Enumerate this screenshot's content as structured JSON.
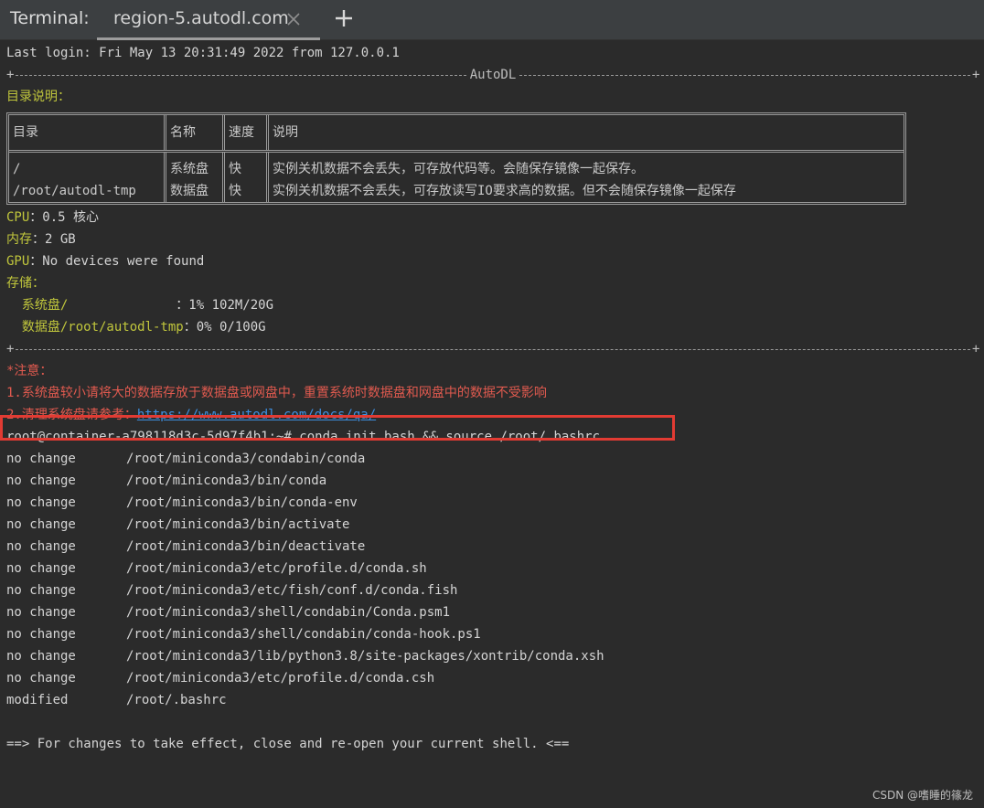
{
  "tabbar": {
    "app_label": "Terminal:",
    "tab_title": "region-5.autodl.com",
    "close_icon": "close-icon",
    "add_icon": "plus-icon"
  },
  "terminal": {
    "last_login": "Last login: Fri May 13 20:31:49 2022 from 127.0.0.1",
    "rule_top_label": "AutoDL",
    "dir_heading": "目录说明：",
    "table": {
      "headers": [
        "目录",
        "名称",
        "速度",
        "说明"
      ],
      "rows": [
        [
          "/",
          "系统盘",
          "快",
          "实例关机数据不会丢失，可存放代码等。会随保存镜像一起保存。"
        ],
        [
          "/root/autodl-tmp",
          "数据盘",
          "快",
          "实例关机数据不会丢失，可存放读写IO要求高的数据。但不会随保存镜像一起保存"
        ]
      ]
    },
    "cpu_label": "CPU",
    "cpu_value": "：0.5 核心",
    "mem_label": "内存",
    "mem_value": "：2 GB",
    "gpu_label": "GPU",
    "gpu_value": "：No devices were found",
    "storage_label": "存储：",
    "sys_disk_label": "  系统盘/",
    "sys_disk_value": "              ：1% 102M/20G",
    "data_disk_label": "  数据盘/root/autodl-tmp",
    "data_disk_value": "：0% 0/100G",
    "notice_label": "*注意：",
    "notice_1": "1.系统盘较小请将大的数据存放于数据盘或网盘中，重置系统时数据盘和网盘中的数据不受影响",
    "notice_2_prefix": "2.清理系统盘请参考：",
    "notice_2_link": "https://www.autodl.com/docs/qa/",
    "prompt_command": "root@container-a798118d3c-5d97f4b1:~# conda init bash && source /root/.bashrc",
    "outputs": [
      {
        "status": "no change",
        "path": "/root/miniconda3/condabin/conda"
      },
      {
        "status": "no change",
        "path": "/root/miniconda3/bin/conda"
      },
      {
        "status": "no change",
        "path": "/root/miniconda3/bin/conda-env"
      },
      {
        "status": "no change",
        "path": "/root/miniconda3/bin/activate"
      },
      {
        "status": "no change",
        "path": "/root/miniconda3/bin/deactivate"
      },
      {
        "status": "no change",
        "path": "/root/miniconda3/etc/profile.d/conda.sh"
      },
      {
        "status": "no change",
        "path": "/root/miniconda3/etc/fish/conf.d/conda.fish"
      },
      {
        "status": "no change",
        "path": "/root/miniconda3/shell/condabin/Conda.psm1"
      },
      {
        "status": "no change",
        "path": "/root/miniconda3/shell/condabin/conda-hook.ps1"
      },
      {
        "status": "no change",
        "path": "/root/miniconda3/lib/python3.8/site-packages/xontrib/conda.xsh"
      },
      {
        "status": "no change",
        "path": "/root/miniconda3/etc/profile.d/conda.csh"
      },
      {
        "status": "modified",
        "path": "/root/.bashrc"
      }
    ],
    "final_message": "==> For changes to take effect, close and re-open your current shell. <=="
  },
  "watermark": "CSDN @嗜睡的篠龙",
  "colors": {
    "background": "#2b2b2b",
    "tabbar": "#3c3f41",
    "yellow": "#c0c63c",
    "red": "#e05a4f",
    "link": "#3d8fe0",
    "highlight_box": "#e23b33"
  }
}
